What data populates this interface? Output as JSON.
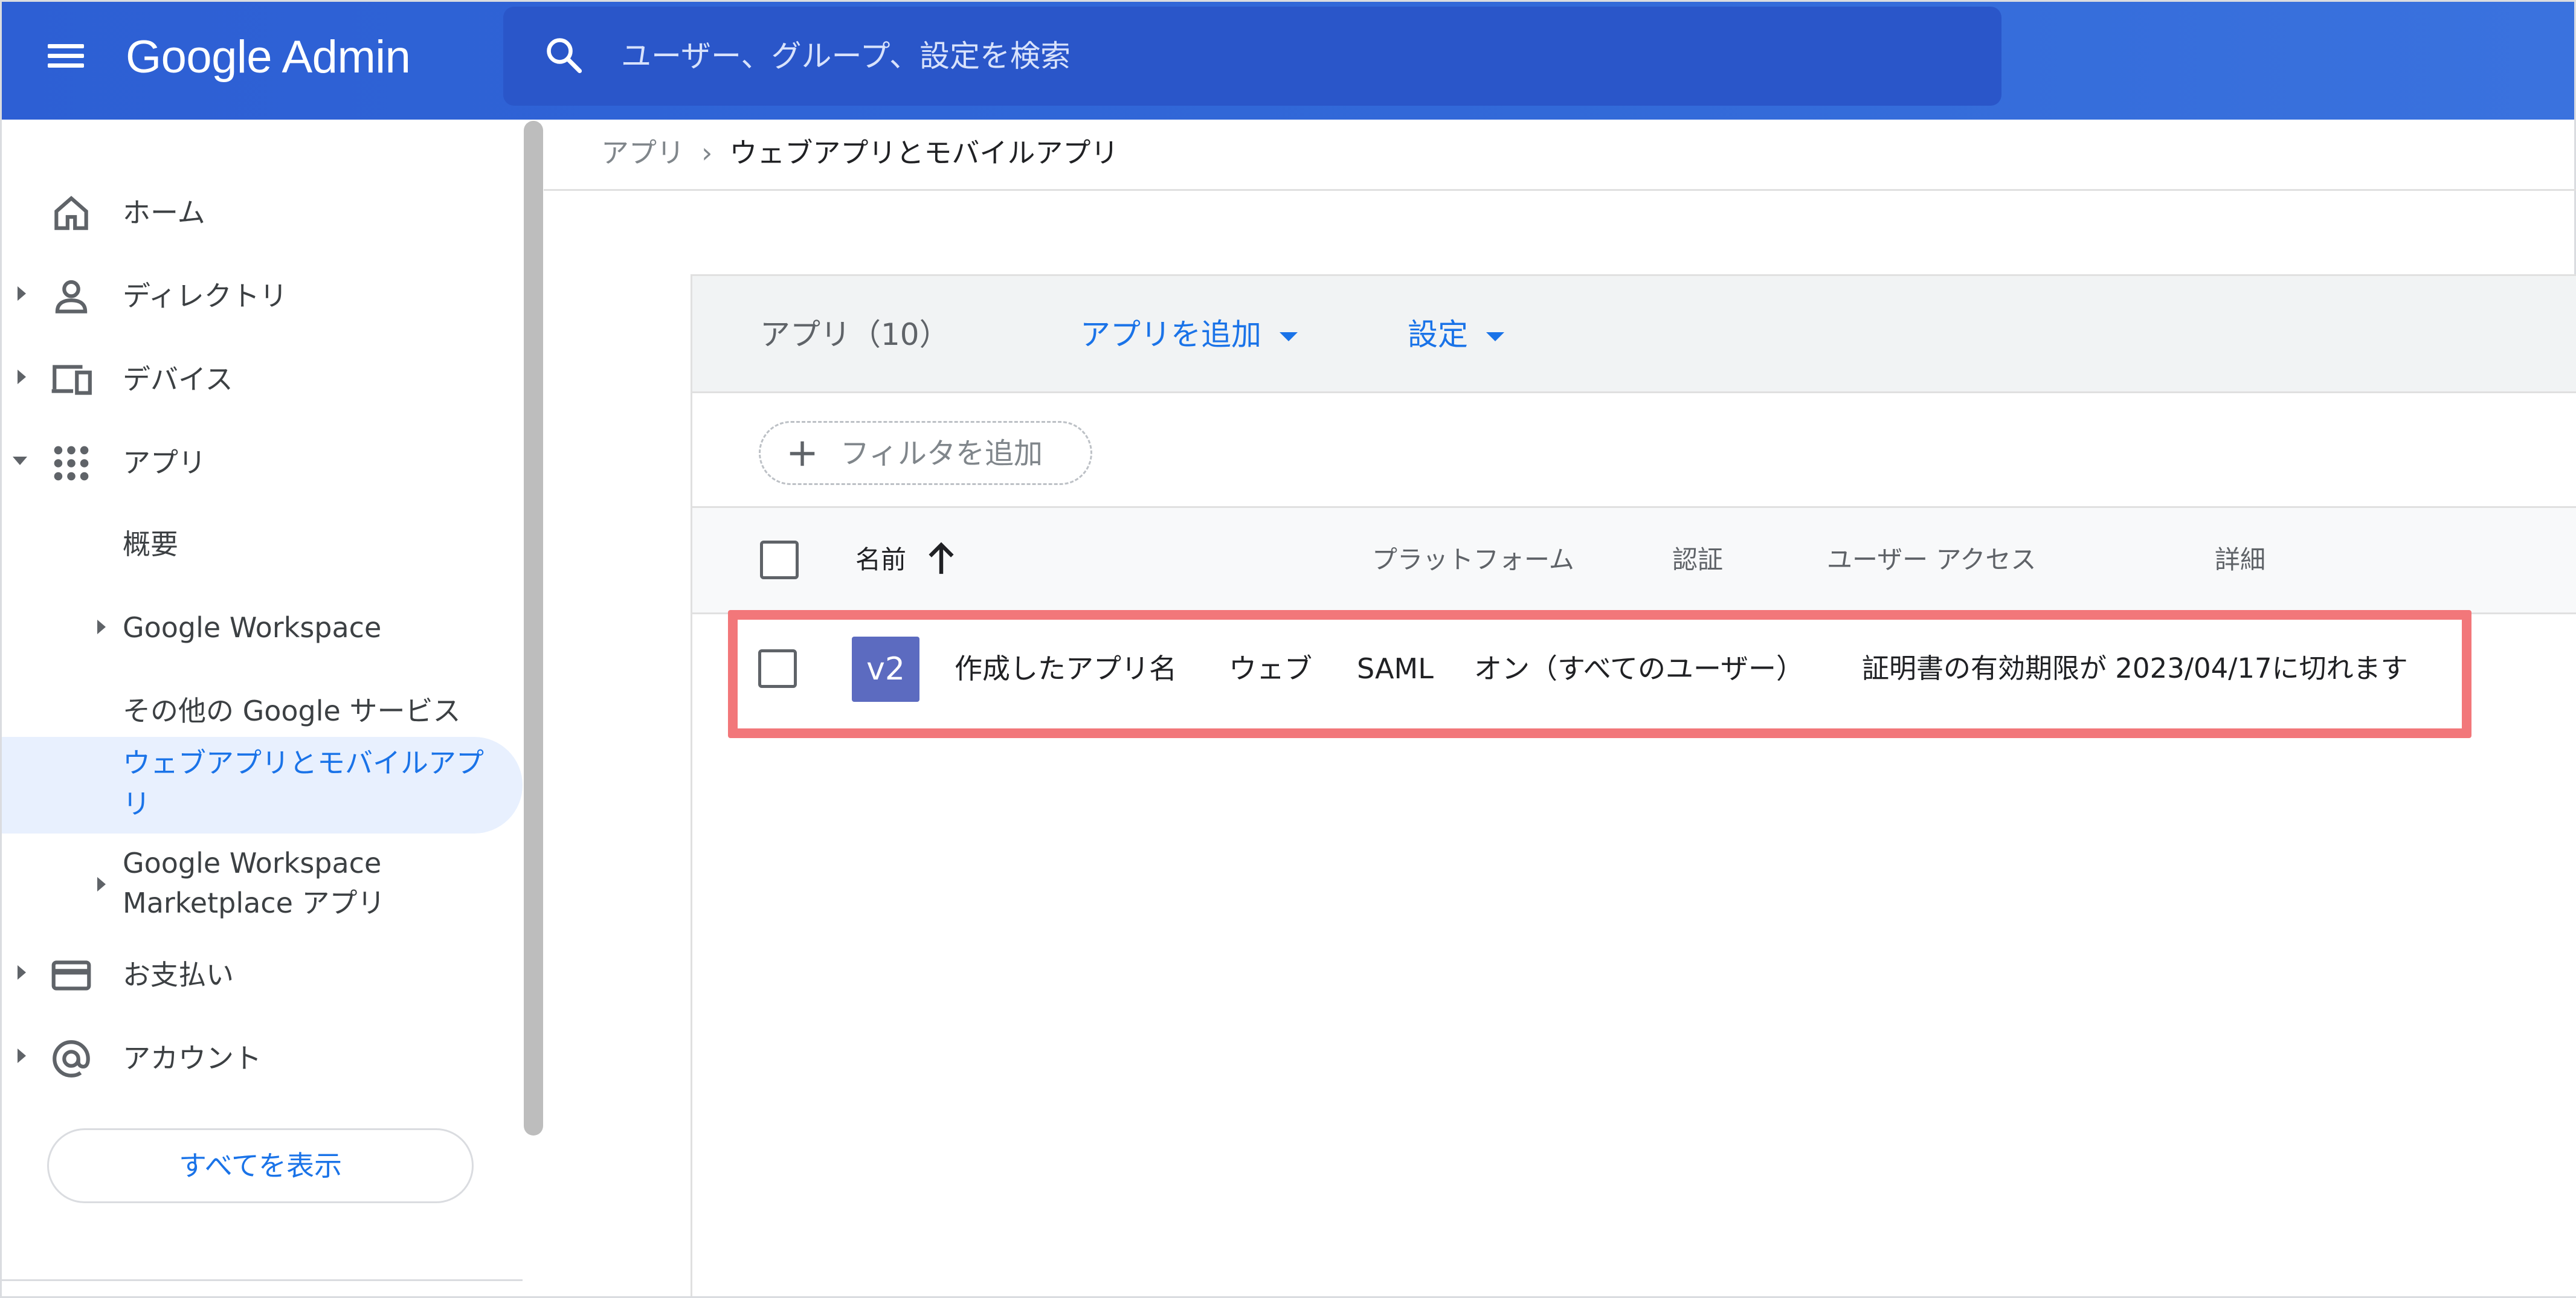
{
  "header": {
    "logo": "Google Admin",
    "search_placeholder": "ユーザー、グループ、設定を検索"
  },
  "sidebar": {
    "items": [
      {
        "label": "ホーム",
        "icon": "home-icon"
      },
      {
        "label": "ディレクトリ",
        "icon": "person-icon"
      },
      {
        "label": "デバイス",
        "icon": "devices-icon"
      },
      {
        "label": "アプリ",
        "icon": "apps-grid-icon"
      },
      {
        "label": "お支払い",
        "icon": "credit-card-icon"
      },
      {
        "label": "アカウント",
        "icon": "at-sign-icon"
      }
    ],
    "apps_sub": [
      {
        "label": "概要"
      },
      {
        "label": "Google Workspace"
      },
      {
        "label": "その他の Google サービス"
      },
      {
        "label_line1": "ウェブアプリとモバイルアプ",
        "label_line2": "リ"
      },
      {
        "label_line1": "Google Workspace",
        "label_line2": "Marketplace アプリ"
      }
    ],
    "show_all": "すべてを表示"
  },
  "breadcrumb": {
    "parent": "アプリ",
    "separator": "›",
    "current": "ウェブアプリとモバイルアプリ"
  },
  "toolbar": {
    "apps_count": "アプリ（10）",
    "add_app": "アプリを追加",
    "settings": "設定"
  },
  "filter": {
    "label": "フィルタを追加"
  },
  "table": {
    "columns": [
      "名前",
      "プラットフォーム",
      "認証",
      "ユーザー アクセス",
      "詳細"
    ],
    "rows": [
      {
        "badge": "v2",
        "name": "作成したアプリ名",
        "platform": "ウェブ",
        "auth": "SAML",
        "access": "オン（すべてのユーザー）",
        "details": "証明書の有効期限が 2023/04/17に切れます"
      }
    ]
  },
  "colors": {
    "header_blue": "#2d5fd4",
    "accent": "#1a73e8",
    "highlight": "#f2777a",
    "badge": "#5c6bc0"
  }
}
